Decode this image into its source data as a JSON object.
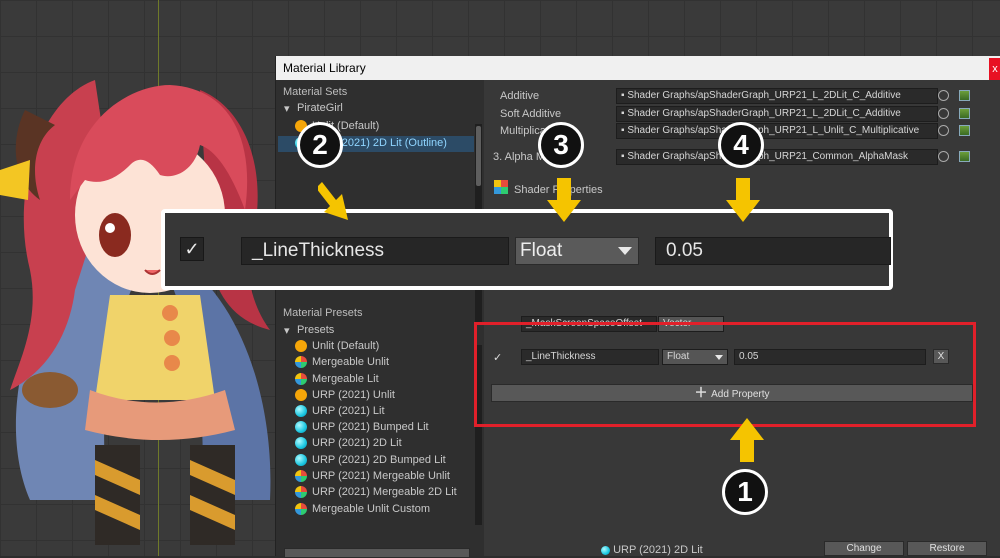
{
  "window": {
    "title": "Material Library",
    "close_label": "x"
  },
  "left": {
    "material_sets_header": "Material Sets",
    "set_group": "PirateGirl",
    "set_items": [
      {
        "label": "Unlit (Default)",
        "icon": "orange-sphere-icon"
      },
      {
        "label": "URP (2021) 2D Lit (Outline)",
        "icon": "cyan-sphere-icon",
        "selected": true
      }
    ],
    "presets_header": "Material Presets",
    "presets_group": "Presets",
    "preset_items": [
      {
        "label": "Unlit (Default)",
        "icon": "orange"
      },
      {
        "label": "Mergeable Unlit",
        "icon": "multi"
      },
      {
        "label": "Mergeable Lit",
        "icon": "multi"
      },
      {
        "label": "URP (2021) Unlit",
        "icon": "orange"
      },
      {
        "label": "URP (2021) Lit",
        "icon": "cyan"
      },
      {
        "label": "URP (2021) Bumped Lit",
        "icon": "cyan"
      },
      {
        "label": "URP (2021) 2D Lit",
        "icon": "cyan"
      },
      {
        "label": "URP (2021) 2D Bumped Lit",
        "icon": "cyan"
      },
      {
        "label": "URP (2021) Mergeable Unlit",
        "icon": "multi"
      },
      {
        "label": "URP (2021) Mergeable 2D Lit",
        "icon": "multi"
      },
      {
        "label": "Mergeable Unlit Custom",
        "icon": "multi"
      }
    ]
  },
  "right": {
    "shader_rows": [
      {
        "label": "Additive",
        "value": "Shader Graphs/apShaderGraph_URP21_L_2DLit_C_Additive"
      },
      {
        "label": "Soft Additive",
        "value": "Shader Graphs/apShaderGraph_URP21_L_2DLit_C_Additive"
      },
      {
        "label": "Multiplicative",
        "value": "Shader Graphs/apShaderGraph_URP21_L_Unlit_C_Multiplicative"
      },
      {
        "label": "3. Alpha Mask",
        "value": "Shader Graphs/apShaderGraph_URP21_Common_AlphaMask"
      }
    ],
    "shader_properties_header": "Shader Properties",
    "hidden_property": "_MaskScreenSpaceOffset",
    "hidden_type": "Vector",
    "property": {
      "checked": "✓",
      "name": "_LineThickness",
      "type": "Float",
      "value": "0.05",
      "remove": "X"
    },
    "add_property_label": "Add Property",
    "bottom_selected": "URP (2021) 2D Lit",
    "change_label": "Change",
    "restore_label": "Restore"
  },
  "zoom": {
    "checked": "✓",
    "name": "_LineThickness",
    "type": "Float",
    "value": "0.05"
  },
  "callouts": [
    "1",
    "2",
    "3",
    "4"
  ],
  "colors": {
    "callout_arrow": "#f5c400",
    "highlight_box": "#e1202a",
    "selected_row": "#2c4b66"
  }
}
